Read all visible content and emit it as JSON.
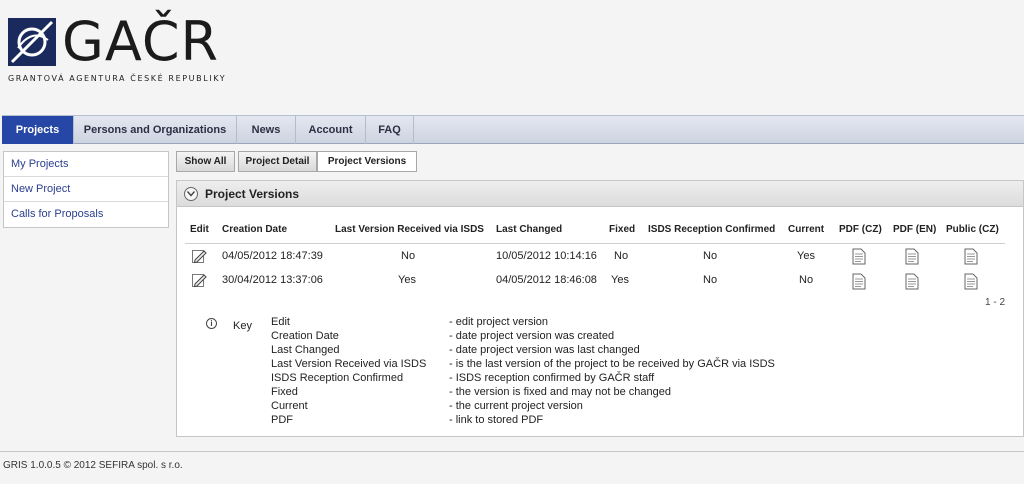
{
  "logo": {
    "title": "GAČR",
    "subtitle": "GRANTOVÁ AGENTURA ČESKÉ REPUBLIKY",
    "icon": "gacr-logo-mark"
  },
  "nav": {
    "tabs": [
      {
        "label": "Projects",
        "active": true
      },
      {
        "label": "Persons and Organizations",
        "active": false
      },
      {
        "label": "News",
        "active": false
      },
      {
        "label": "Account",
        "active": false
      },
      {
        "label": "FAQ",
        "active": false
      }
    ]
  },
  "sidebar": {
    "items": [
      {
        "label": "My Projects"
      },
      {
        "label": "New Project"
      },
      {
        "label": "Calls for Proposals"
      }
    ]
  },
  "subtabs": [
    {
      "label": "Show All"
    },
    {
      "label": "Project Detail"
    },
    {
      "label": "Project Versions",
      "active": true
    }
  ],
  "panel": {
    "title": "Project Versions",
    "columns": [
      "Edit",
      "Creation Date",
      "Last Version Received via ISDS",
      "Last Changed",
      "Fixed",
      "ISDS Reception Confirmed",
      "Current",
      "PDF (CZ)",
      "PDF (EN)",
      "Public (CZ)"
    ],
    "rows": [
      {
        "creation_date": "04/05/2012 18:47:39",
        "last_version_isds": "No",
        "last_changed": "10/05/2012 10:14:16",
        "fixed": "No",
        "isds_confirmed": "No",
        "current": "Yes"
      },
      {
        "creation_date": "30/04/2012 13:37:06",
        "last_version_isds": "Yes",
        "last_changed": "04/05/2012 18:46:08",
        "fixed": "Yes",
        "isds_confirmed": "No",
        "current": "No"
      }
    ],
    "pager": "1 - 2",
    "key": {
      "label": "Key",
      "entries": [
        {
          "term": "Edit",
          "desc": "- edit project version"
        },
        {
          "term": "Creation Date",
          "desc": "- date project version was created"
        },
        {
          "term": "Last Changed",
          "desc": "- date project version was last changed"
        },
        {
          "term": "Last Version Received via ISDS",
          "desc": "- is the last version of the project to be received by GAČR via ISDS"
        },
        {
          "term": "ISDS Reception Confirmed",
          "desc": "- ISDS reception confirmed by GAČR staff"
        },
        {
          "term": "Fixed",
          "desc": "- the version is fixed and may not be changed"
        },
        {
          "term": "Current",
          "desc": "- the current project version"
        },
        {
          "term": "PDF",
          "desc": "- link to stored PDF"
        }
      ]
    }
  },
  "footer": {
    "text": "GRIS 1.0.0.5 © 2012 SEFIRA spol. s r.o."
  },
  "colors": {
    "nav_active": "#2747a6",
    "link": "#2a3f8e",
    "brand_dark": "#1b2a5c"
  }
}
